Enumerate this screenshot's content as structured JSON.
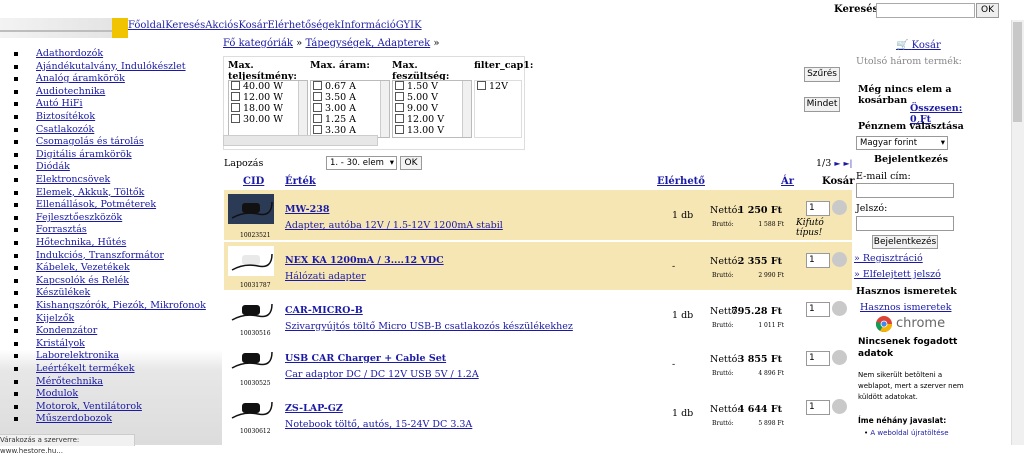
{
  "header": {
    "nav": [
      "Főoldal",
      "Keresés",
      "Akciós",
      "Kosár",
      "Elérhetőségek",
      "Információ",
      "GYIK"
    ],
    "search_label": "Keresés:",
    "search_value": "",
    "search_button": "OK"
  },
  "sidebar": {
    "categories": [
      "Adathordozók",
      "Ajándékutalvány, Indulókészlet",
      "Analóg áramkörök",
      "Audiotechnika",
      "Autó HiFi",
      "Biztosítékok",
      "Csatlakozók",
      "Csomagolás és tárolás",
      "Digitális áramkörök",
      "Diódák",
      "Elektroncsövek",
      "Elemek, Akkuk, Töltők",
      "Ellenállások, Potméterek",
      "Fejlesztőeszközök",
      "Forrasztás",
      "Hőtechnika, Hűtés",
      "Indukciós, Transzformátor",
      "Kábelek, Vezetékek",
      "Kapcsolók és Relék",
      "Készülékek",
      "Kishangszórók, Piezók, Mikrofonok",
      "Kijelzők",
      "Kondenzátor",
      "Kristályok",
      "Laborelektronika",
      "Leértékelt termékek",
      "Mérőtechnika",
      "Modulok",
      "Motorok, Ventilátorok",
      "Műszerdobozok"
    ]
  },
  "breadcrumb": {
    "root": "Fő kategóriák",
    "sep": "»",
    "current": "Tápegységek, Adapterek",
    "tail": "»"
  },
  "filters": {
    "columns": [
      {
        "title": "Max. teljesítmény:",
        "options": [
          "40.00 W",
          "12.00 W",
          "18.00 W",
          "30.00 W"
        ]
      },
      {
        "title": "Max. áram:",
        "options": [
          "0.67 A",
          "3.50 A",
          "3.00 A",
          "1.25 A",
          "3.30 A"
        ]
      },
      {
        "title": "Max. feszültség:",
        "options": [
          "1.50 V",
          "5.00 V",
          "9.00 V",
          "12.00 V",
          "13.00 V"
        ]
      },
      {
        "title": "filter_cap1:",
        "options": [
          "12V"
        ]
      }
    ],
    "filter_button": "Szűrés",
    "all_button": "Mindet"
  },
  "paging": {
    "label": "Lapozás",
    "range": "1. - 30. elem",
    "ok": "OK",
    "page": "1/3",
    "next": "►",
    "last": "►|"
  },
  "table": {
    "headers": {
      "cid": "CID",
      "name": "Érték",
      "stock": "Elérhető",
      "price": "Ár",
      "cart": "Kosár"
    },
    "netto_label": "Nettó:",
    "brutto_label": "Bruttó:",
    "rows": [
      {
        "cid": "10023521",
        "name": "MW-238",
        "desc": "Adapter, autóba 12V / 1.5-12V 1200mA stabil",
        "stock": "1 db",
        "net": "1 250 Ft",
        "gross": "1 588 Ft",
        "qty": "1",
        "note": "Kifutó típus!",
        "bg": "#f6e6b4"
      },
      {
        "cid": "10031787",
        "name": "NEX KA 1200mA / 3....12 VDC",
        "desc": "Hálózati adapter",
        "stock": "-",
        "net": "2 355 Ft",
        "gross": "2 990 Ft",
        "qty": "1",
        "note": "",
        "bg": "#f6e6b4"
      },
      {
        "cid": "10030516",
        "name": "CAR-MICRO-B",
        "desc": "Szivargyújtós töltő Micro USB-B csatlakozós készülékekhez",
        "stock": "1 db",
        "net": "795.28 Ft",
        "gross": "1 011 Ft",
        "qty": "1",
        "note": "",
        "bg": "#ffffff"
      },
      {
        "cid": "10030525",
        "name": "USB CAR Charger + Cable Set",
        "desc": "Car adaptor DC / DC 12V USB 5V / 1.2A",
        "stock": "-",
        "net": "3 855 Ft",
        "gross": "4 896 Ft",
        "qty": "1",
        "note": "",
        "bg": "#ffffff"
      },
      {
        "cid": "10030612",
        "name": "ZS-LAP-GZ",
        "desc": "Notebook töltő, autós, 15-24V DC 3.3A",
        "stock": "1 db",
        "net": "4 644 Ft",
        "gross": "5 898 Ft",
        "qty": "1",
        "note": "",
        "bg": "#ffffff"
      }
    ]
  },
  "right": {
    "cart_link": "Kosár",
    "recent": "Utolsó három termék:",
    "empty": "Még nincs elem a kosárban",
    "total": "Összesen: 0 Ft",
    "currency_title": "Pénznem választása",
    "currency_value": "Magyar forint",
    "login_title": "Bejelentkezés",
    "email_label": "E-mail cím:",
    "password_label": "Jelszó:",
    "login_button": "Bejelentkezés",
    "register": "» Regisztráció",
    "forgot": "» Elfelejtett jelszó",
    "useful_title": "Hasznos ismeretek",
    "useful_link": "Hasznos ismeretek"
  },
  "chrome_error": {
    "brand": "chrome",
    "title": "Nincsenek fogadott adatok",
    "body": "Nem sikerült betölteni a weblapot, mert a szerver nem küldött adatokat.",
    "tips_title": "Íme néhány javaslat:",
    "tip": "A weboldal újratöltése"
  },
  "status_bar": "Várakozás a szerverre: www.hestore.hu..."
}
